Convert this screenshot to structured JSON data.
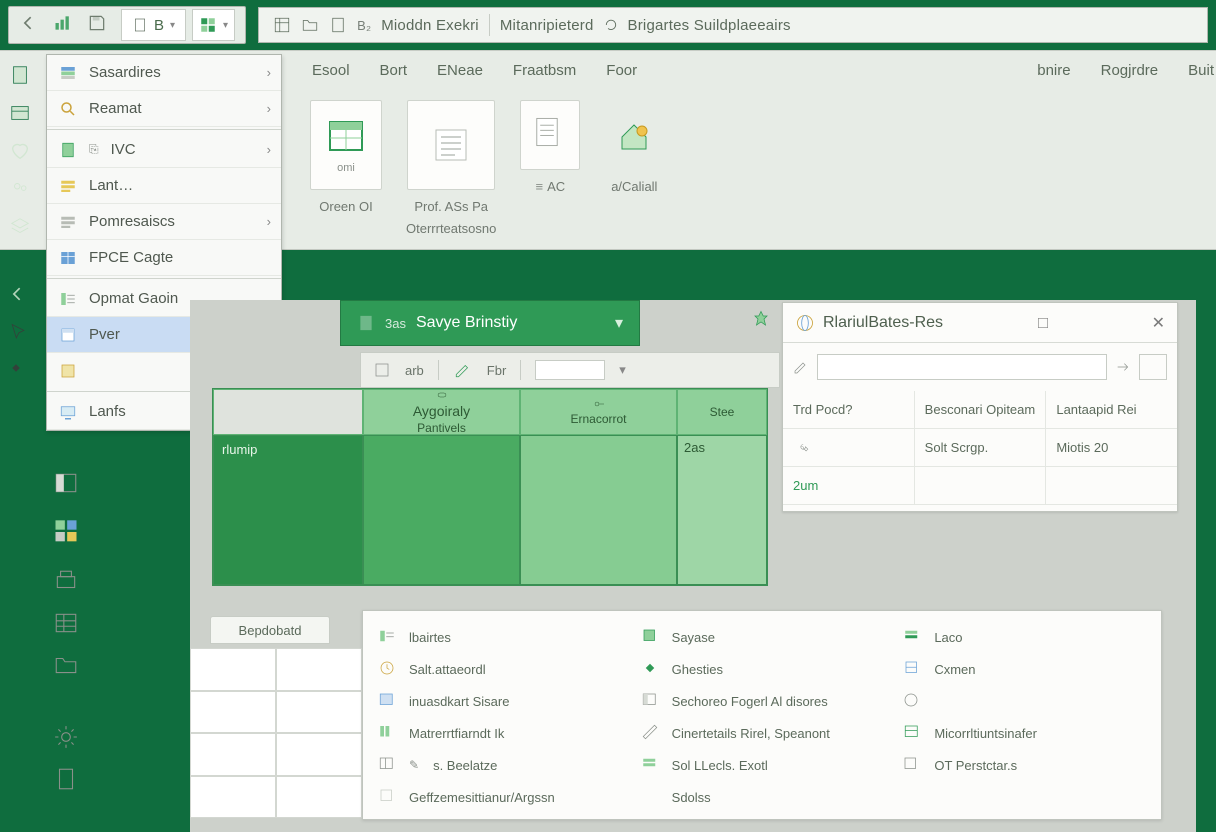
{
  "title": {
    "segments": [
      "Mioddn Exekri",
      "Mitanripieterd",
      "Brigartes Suildplaeeairs"
    ]
  },
  "qat": {
    "b_label": "B"
  },
  "ribbon": {
    "tabs": [
      "Esool",
      "Bort",
      "ENeae",
      "Fraatbsm",
      "Foor",
      "bnire",
      "Rogjrdre",
      "Buit"
    ],
    "groups": {
      "order": "Oreen OI",
      "prof": "Prof. ASs Pa",
      "orient": "Oterrrteatsosno",
      "ac": "AC",
      "calc": "a/Caliall"
    }
  },
  "leftstrip_names": [
    "document-icon",
    "sheet-icon",
    "heart-icon",
    "users-icon",
    "layers-icon"
  ],
  "menu": {
    "items": [
      {
        "label": "Sasardires",
        "submenu": true
      },
      {
        "label": "Reamat",
        "submenu": true
      },
      {
        "label": "IVC",
        "submenu": true
      },
      {
        "label": "Lant…",
        "submenu": false
      },
      {
        "label": "Pomresaiscs",
        "submenu": true
      },
      {
        "label": "FPCE Cagte",
        "submenu": false
      },
      {
        "label": "Opmat Gaoin",
        "submenu": false
      },
      {
        "label": "Pver",
        "submenu": false,
        "highlight": true
      },
      {
        "label": "",
        "submenu": false,
        "iconOnly": true
      },
      {
        "label": "Lanfs",
        "submenu": false
      }
    ]
  },
  "doc_header": {
    "pre": "3as",
    "title": "Savye Brinstiy"
  },
  "doc_toolbar": {
    "a": "arb",
    "b": "Fbr"
  },
  "green_table": {
    "head": [
      {
        "top": "Aygoiraly",
        "bot": "Pantivels"
      },
      {
        "top": "",
        "bot": "Ernacorrot"
      },
      {
        "top": "",
        "bot": "Stee"
      }
    ],
    "row_label": "rlumip",
    "last_cell": "2as"
  },
  "right_panel": {
    "title": "RlariulBates-Res",
    "head": [
      "Trd Pocd?",
      "Besconari Opiteam",
      "Lantaapid Rei"
    ],
    "row": [
      "",
      "Solt Scrgp.",
      "Miotis 20"
    ],
    "val": "2um"
  },
  "options_panel": {
    "col1": [
      "lbairtes",
      "Salt.attaeordl",
      "inuasdkart Sisare",
      "Matrerrtfiarndt Ik",
      "s. Beelatze",
      "Geffzemesittianur/Argssn"
    ],
    "col2": [
      "Sayase",
      "Ghesties",
      "Sechoreo Fogerl Al disores",
      "Cinertetails Rirel,     Speanont",
      "Sol LLecls. Exotl",
      "Sdolss"
    ],
    "col3": [
      "Laco",
      "Cxmen",
      "",
      "Micorrltiuntsinafer",
      "OT Perstctar.s",
      ""
    ]
  },
  "sheet_tab": "Bepdobatd"
}
